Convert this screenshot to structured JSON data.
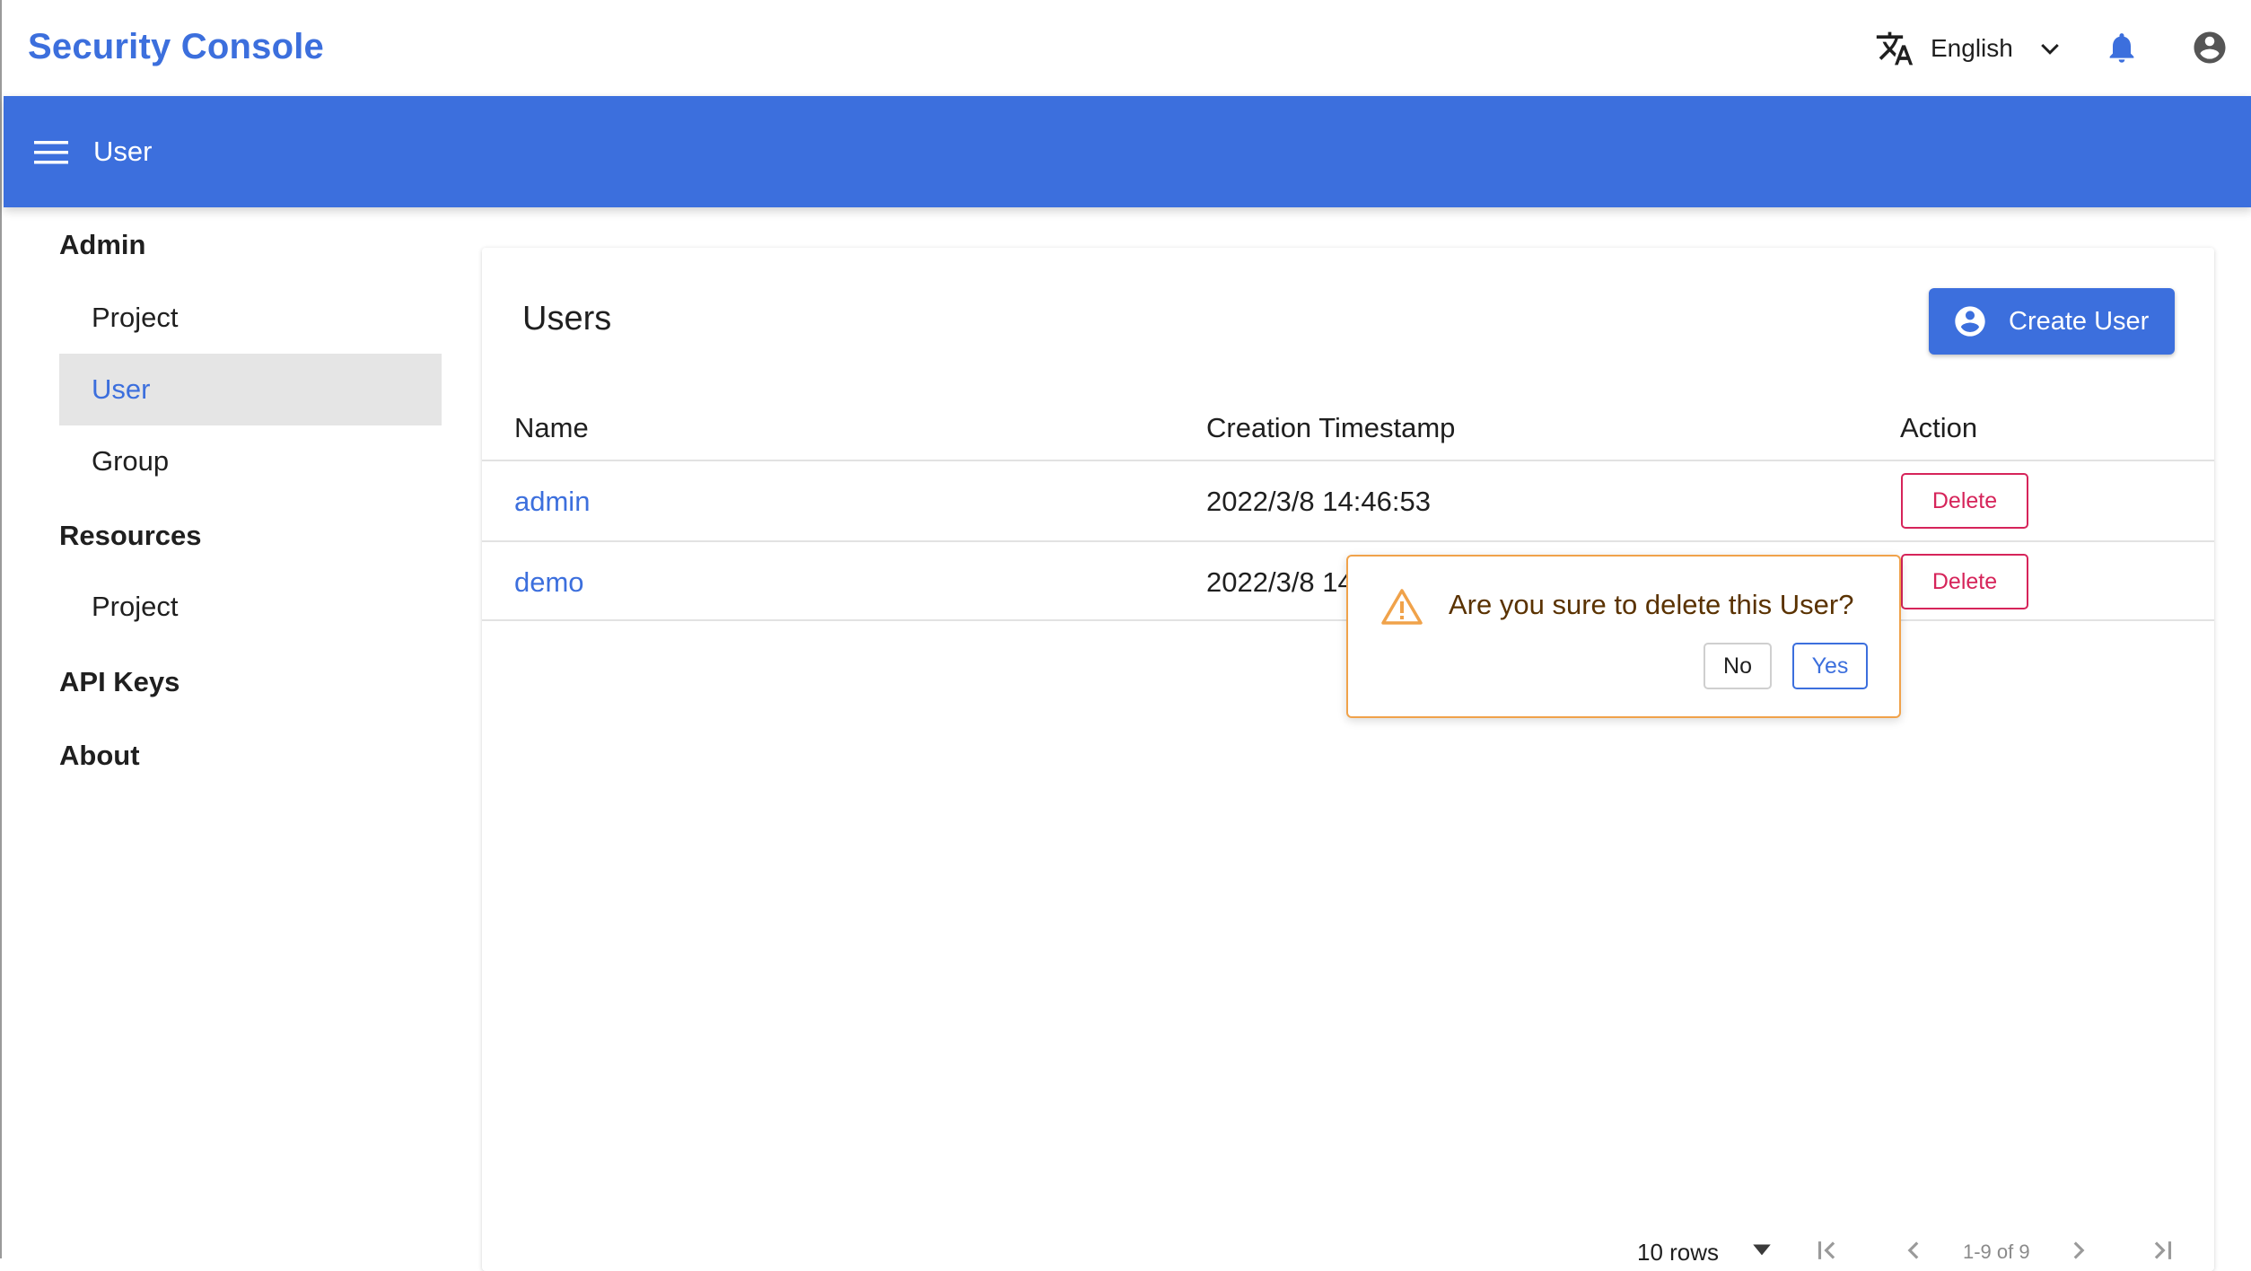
{
  "header": {
    "app_title": "Security Console",
    "language": "English",
    "icons": [
      "translate-icon",
      "chevron-down-icon",
      "bell-icon",
      "account-circle-icon"
    ]
  },
  "navbar": {
    "title": "User",
    "menu_icon": "menu-icon"
  },
  "sidebar": {
    "groups": [
      {
        "label": "Admin",
        "items": [
          {
            "label": "Project",
            "active": false
          },
          {
            "label": "User",
            "active": true
          },
          {
            "label": "Group",
            "active": false
          }
        ]
      },
      {
        "label": "Resources",
        "items": [
          {
            "label": "Project",
            "active": false
          }
        ]
      },
      {
        "label": "API Keys",
        "items": []
      },
      {
        "label": "About",
        "items": []
      }
    ]
  },
  "main": {
    "title": "Users",
    "create_button": "Create User",
    "columns": [
      "Name",
      "Creation Timestamp",
      "Action"
    ],
    "rows": [
      {
        "name": "admin",
        "created": "2022/3/8 14:46:53",
        "action": "Delete"
      },
      {
        "name": "demo",
        "created": "2022/3/8 14",
        "action": "Delete"
      }
    ],
    "pagination": {
      "rows_per_page": "10 rows",
      "range": "1-9 of 9"
    }
  },
  "popconfirm": {
    "message": "Are you sure to delete this User?",
    "no_label": "No",
    "yes_label": "Yes"
  },
  "colors": {
    "brand": "#3c6fdd",
    "danger": "#d6245a",
    "warning": "#f0a24a"
  }
}
